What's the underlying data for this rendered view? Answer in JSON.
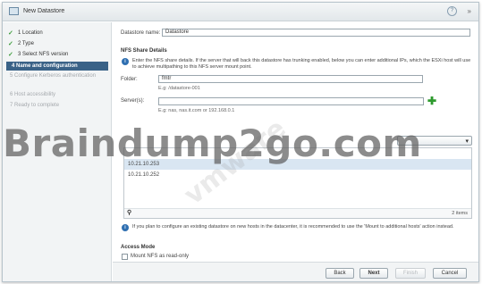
{
  "window": {
    "title": "New Datastore",
    "help_icon": "?",
    "expand_icon": "»"
  },
  "steps": [
    {
      "num": "1",
      "label": "Location",
      "state": "done"
    },
    {
      "num": "2",
      "label": "Type",
      "state": "done"
    },
    {
      "num": "3",
      "label": "Select NFS version",
      "state": "done"
    },
    {
      "num": "4",
      "label": "Name and configuration",
      "state": "active"
    },
    {
      "num": "5",
      "label": "Configure Kerberos authentication",
      "state": "disabled"
    },
    {
      "num": "6",
      "label": "Host accessibility",
      "state": "disabled"
    },
    {
      "num": "7",
      "label": "Ready to complete",
      "state": "disabled"
    }
  ],
  "form": {
    "datastore_name_label": "Datastore name:",
    "datastore_name_value": "Datastore",
    "nfs_section_title": "NFS Share Details",
    "info_text": "Enter the NFS share details. If the server that will back this datastore has trunking enabled, below you can enter additional IPs, which the ESXi host will use to achieve multipathing to this NFS server mount point.",
    "folder_label": "Folder:",
    "folder_value": "fmtr",
    "folder_hint": "E.g: /datastore-001",
    "servers_label": "Server(s):",
    "servers_value": "",
    "servers_hint": "E.g: nas, nas.it.com or 192.168.0.1",
    "server_list": [
      "10.21.10.253",
      "10.21.10.252"
    ],
    "items_count": "2 items",
    "warning_text": "If you plan to configure an existing datastore on new hosts in the datacenter, it is recommended to use the 'Mount to additional hosts' action instead.",
    "access_mode_title": "Access Mode",
    "readonly_label": "Mount NFS as read-only"
  },
  "buttons": {
    "back": "Back",
    "next": "Next",
    "finish": "Finish",
    "cancel": "Cancel"
  },
  "watermarks": {
    "main": "Braindump2go.com",
    "diagonal": "vmware"
  }
}
